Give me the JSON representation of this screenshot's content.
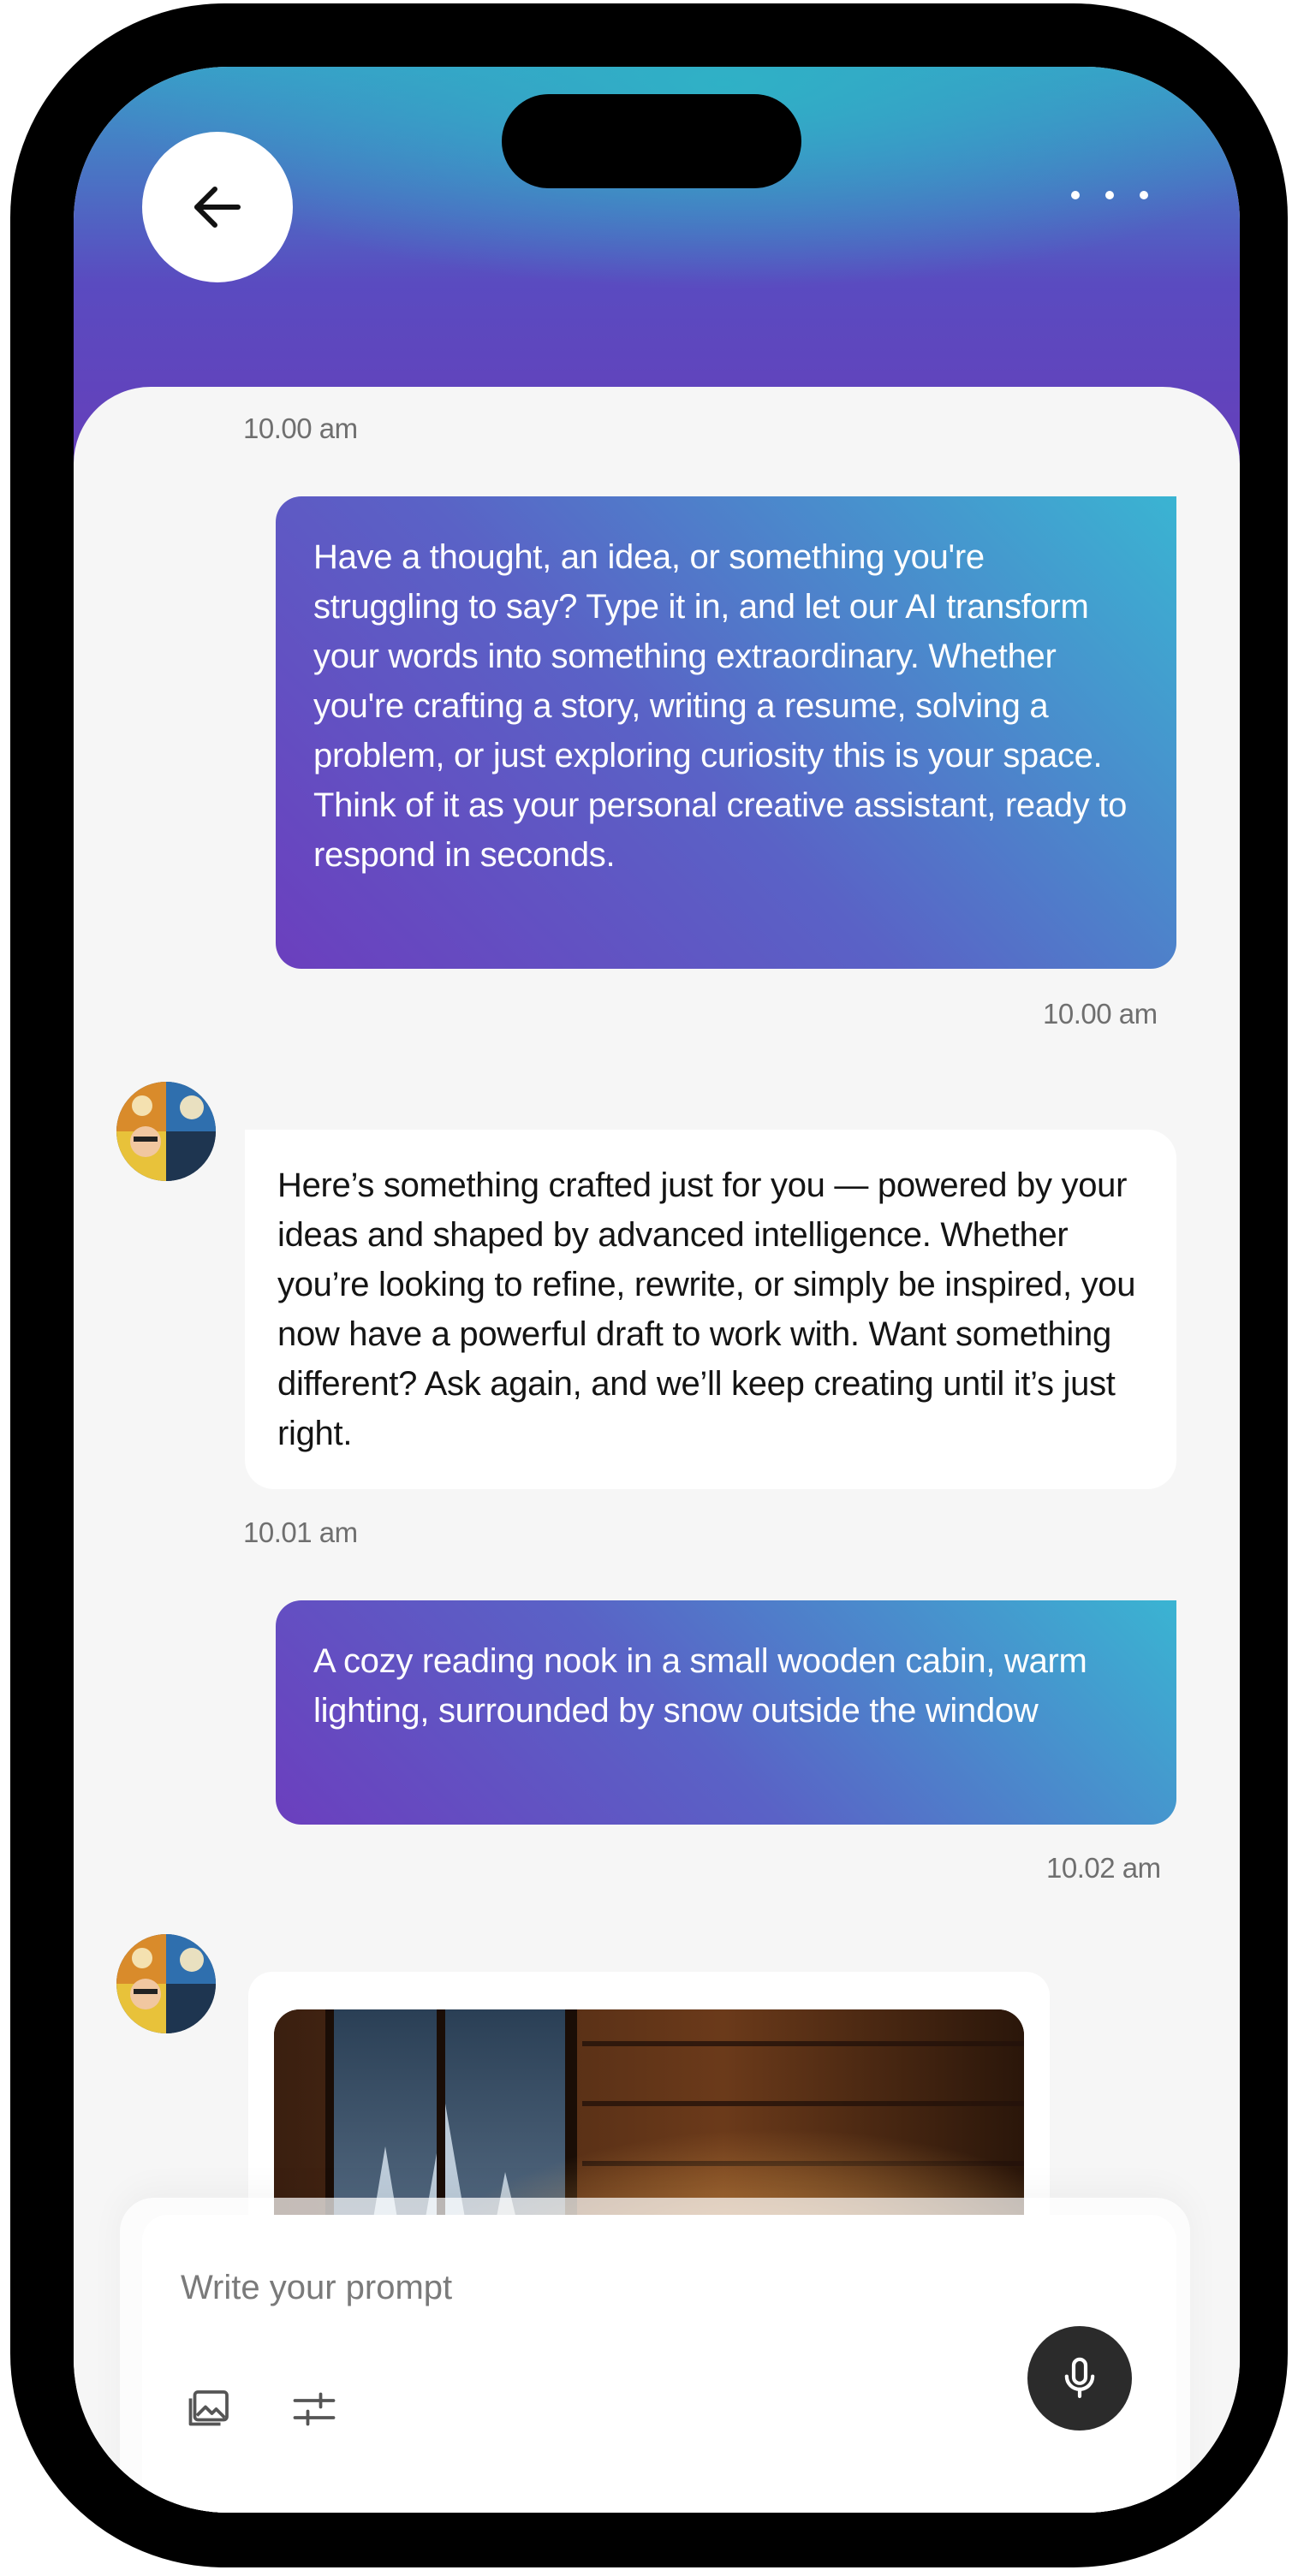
{
  "header": {
    "back_icon": "arrow-left-icon",
    "more_icon": "more-horizontal-icon"
  },
  "messages": [
    {
      "sender": "user",
      "time": "10.00 am",
      "text": "Have a thought, an idea, or something you're struggling to say? Type it in, and let our AI transform your words into something extraordinary. Whether you're crafting a story, writing a resume, solving a problem, or just exploring curiosity this is your space. Think of it as your personal creative assistant, ready to respond in seconds."
    },
    {
      "sender": "ai",
      "time": "10.00 am",
      "text": "Here’s something crafted just for you — powered by your ideas and shaped by advanced intelligence. Whether you’re looking to refine, rewrite, or simply be inspired, you now have a powerful draft to work with. Want something different? Ask again, and we’ll keep creating until it’s just right."
    },
    {
      "sender": "user",
      "time": "10.01 am",
      "text": "A cozy reading nook in a small wooden cabin, warm lighting, surrounded by snow outside the window"
    },
    {
      "sender": "ai",
      "time": "10.02 am",
      "type": "image"
    }
  ],
  "composer": {
    "placeholder": "Write your prompt",
    "image_icon": "image-icon",
    "settings_icon": "sliders-icon",
    "mic_icon": "microphone-icon"
  },
  "colors": {
    "gradient_start": "#6b3fbe",
    "gradient_end": "#3ab4d2",
    "background": "#f6f6f6",
    "mic_button": "#2b2b2b"
  }
}
